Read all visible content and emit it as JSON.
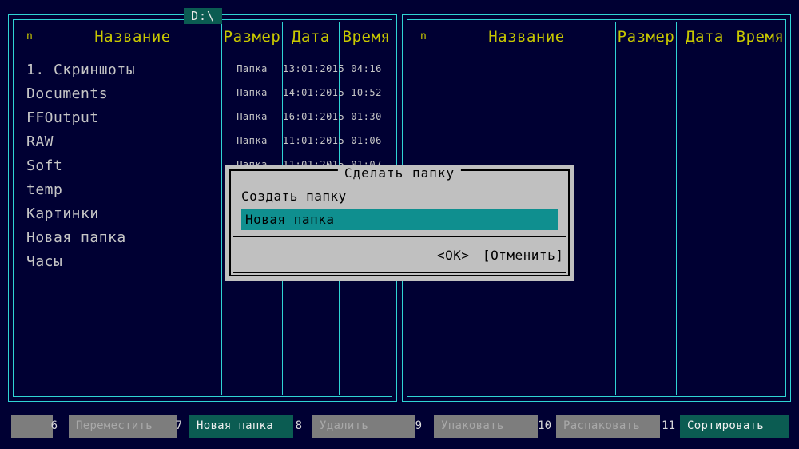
{
  "app": {
    "title_tab": "D:\\",
    "background": "#000033",
    "frame_color": "#2fd4d4",
    "header_color": "#c8c800",
    "text_color": "#c6c6c6",
    "accent_teal": "#0b5c52",
    "input_teal": "#0f8f8f",
    "dialog_bg": "#c0c0c0"
  },
  "left_panel": {
    "title": "D:\\",
    "columns": {
      "index": "n",
      "name": "Название",
      "size": "Размер",
      "date": "Дата",
      "time": "Время"
    },
    "rows": [
      {
        "name": "1. Скриншоты",
        "size": "Папка",
        "date": "13:01:2015",
        "time": "04:16"
      },
      {
        "name": "Documents",
        "size": "Папка",
        "date": "14:01:2015",
        "time": "10:52"
      },
      {
        "name": "FFOutput",
        "size": "Папка",
        "date": "16:01:2015",
        "time": "01:30"
      },
      {
        "name": "RAW",
        "size": "Папка",
        "date": "11:01:2015",
        "time": "01:06"
      },
      {
        "name": "Soft",
        "size": "Папка",
        "date": "11:01:2015",
        "time": "01:07"
      },
      {
        "name": "temp",
        "size": "",
        "date": "",
        "time": ""
      },
      {
        "name": "Картинки",
        "size": "",
        "date": "",
        "time": ""
      },
      {
        "name": "Новая папка",
        "size": "",
        "date": "",
        "time": ""
      },
      {
        "name": "Часы",
        "size": "",
        "date": "",
        "time": ""
      }
    ]
  },
  "right_panel": {
    "columns": {
      "index": "n",
      "name": "Название",
      "size": "Размер",
      "date": "Дата",
      "time": "Время"
    },
    "rows": []
  },
  "dialog": {
    "title": "Сделать папку",
    "label": "Создать папку",
    "input_value": "Новая папка",
    "input_placeholder": "Новая папка",
    "ok_label": "<OK>",
    "cancel_label": "[Отменить]"
  },
  "function_bar": [
    {
      "key": "",
      "label": "",
      "state": "blank"
    },
    {
      "key": "6",
      "label": "Переместить",
      "state": "dim"
    },
    {
      "key": "7",
      "label": "Новая папка",
      "state": "active"
    },
    {
      "key": "8",
      "label": "Удалить",
      "state": "dim"
    },
    {
      "key": "9",
      "label": "Упаковать",
      "state": "dim"
    },
    {
      "key": "10",
      "label": "Распаковать",
      "state": "dim"
    },
    {
      "key": "11",
      "label": "Сортировать",
      "state": "active"
    }
  ]
}
